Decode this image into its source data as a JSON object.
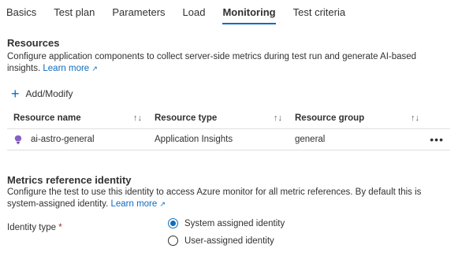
{
  "tabs": [
    {
      "label": "Basics"
    },
    {
      "label": "Test plan"
    },
    {
      "label": "Parameters"
    },
    {
      "label": "Load"
    },
    {
      "label": "Monitoring",
      "active": true
    },
    {
      "label": "Test criteria"
    }
  ],
  "resources": {
    "title": "Resources",
    "description": "Configure application components to collect server-side metrics during test run and generate AI-based insights.",
    "learn_more": "Learn more",
    "add_label": "Add/Modify",
    "columns": [
      "Resource name",
      "Resource type",
      "Resource group"
    ],
    "rows": [
      {
        "name": "ai-astro-general",
        "type": "Application Insights",
        "group": "general",
        "icon": "app-insights-bulb-icon"
      }
    ],
    "more_icon": "more-actions-icon",
    "sort_icon": "sort-arrows-icon"
  },
  "metrics": {
    "title": "Metrics reference identity",
    "description": "Configure the test to use this identity to access Azure monitor for all metric references. By default this is system-assigned identity.",
    "learn_more": "Learn more",
    "identity_label": "Identity type",
    "required_mark": "*",
    "options": [
      {
        "label": "System assigned identity",
        "selected": true
      },
      {
        "label": "User-assigned identity",
        "selected": false
      }
    ]
  },
  "colors": {
    "accent": "#0f6cbd",
    "bulb": "#8661c5",
    "required": "#a4262c"
  }
}
